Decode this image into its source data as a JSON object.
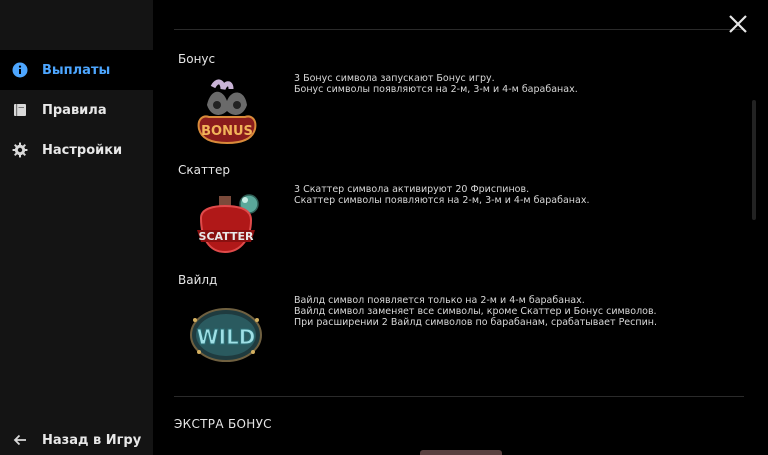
{
  "sidebar": {
    "items": [
      {
        "label": "Выплаты",
        "icon": "info-icon",
        "active": true
      },
      {
        "label": "Правила",
        "icon": "book-icon",
        "active": false
      },
      {
        "label": "Настройки",
        "icon": "gear-icon",
        "active": false
      }
    ],
    "back_label": "Назад в Игру"
  },
  "symbols": [
    {
      "title": "Бонус",
      "image_text": "BONUS",
      "lines": [
        "3 Бонус символа запускают Бонус игру.",
        "Бонус символы появляются на 2-м, 3-м и 4-м барабанах."
      ]
    },
    {
      "title": "Скаттер",
      "image_text": "SCATTER",
      "lines": [
        "3 Скаттер символа активируют 20 Фриспинов.",
        "Скаттер символы появляются на 2-м, 3-м и 4-м барабанах."
      ]
    },
    {
      "title": "Вайлд",
      "image_text": "WILD",
      "lines": [
        "Вайлд символ появляется только на 2-м и 4-м барабанах.",
        "Вайлд символ заменяет все символы, кроме Скаттер и Бонус символов.",
        "При расширении 2 Вайлд символов по барабанам, срабатывает Респин."
      ]
    }
  ],
  "extra_heading": "ЭКСТРА БОНУС",
  "colors": {
    "accent": "#4da6ff",
    "sidebar_bg": "#141414",
    "page_bg": "#000000"
  }
}
